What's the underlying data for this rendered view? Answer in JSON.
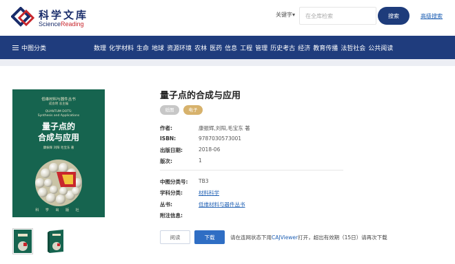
{
  "header": {
    "logo_cn": "科学文库",
    "logo_en_prefix": "Science",
    "logo_en_suffix": "Reading",
    "keyword_select": "关键字▾",
    "search_placeholder": "在全库检索",
    "search_button": "搜索",
    "advanced_search": "高级搜索"
  },
  "nav": {
    "category_label": "中图分类",
    "items": [
      "数理",
      "化学材料",
      "生命",
      "地球",
      "资源环境",
      "农林",
      "医药",
      "信息",
      "工程",
      "管理",
      "历史考古",
      "经济",
      "教育传播",
      "法哲社会",
      "公共阅读"
    ]
  },
  "cover": {
    "series": "低维材料与器件丛书",
    "authors_small": "成会明  总主编",
    "en_title_1": "QUANTUM DOTS:",
    "en_title_2": "Synthesis and Applications",
    "cn_title_1": "量子点的",
    "cn_title_2": "合成与应用",
    "authors": "康振辉  刘阳  毛宝东  著",
    "publisher": "科 学 出 版 社"
  },
  "book": {
    "title": "量子点的合成与应用",
    "tag_print": "纸图",
    "tag_ebook": "电子",
    "fields": {
      "author_label": "作者:",
      "author_value": "康振辉,刘阳,毛宝东 著",
      "isbn_label": "ISBN:",
      "isbn_value": "9787030573001",
      "pubdate_label": "出版日期:",
      "pubdate_value": "2018-06",
      "edition_label": "版次:",
      "edition_value": "1",
      "clc_label": "中图分类号:",
      "clc_value": "TB3",
      "subject_label": "学科分类:",
      "subject_value": "材料科学",
      "series_label": "丛书:",
      "series_value": "低维材料与器件丛书",
      "notes_label": "附注信息:",
      "notes_value": ""
    }
  },
  "actions": {
    "read_button": "阅读",
    "download_button": "下载",
    "note_prefix": "请在连网状态下用",
    "note_link": "CAJViewer",
    "note_suffix": "打开，超出有效期（15日）请再次下载"
  },
  "colors": {
    "brand_navy": "#1f3c7d",
    "link_blue": "#1e5fb3",
    "cover_green": "#16644f",
    "tag_gold": "#d7b26c"
  }
}
